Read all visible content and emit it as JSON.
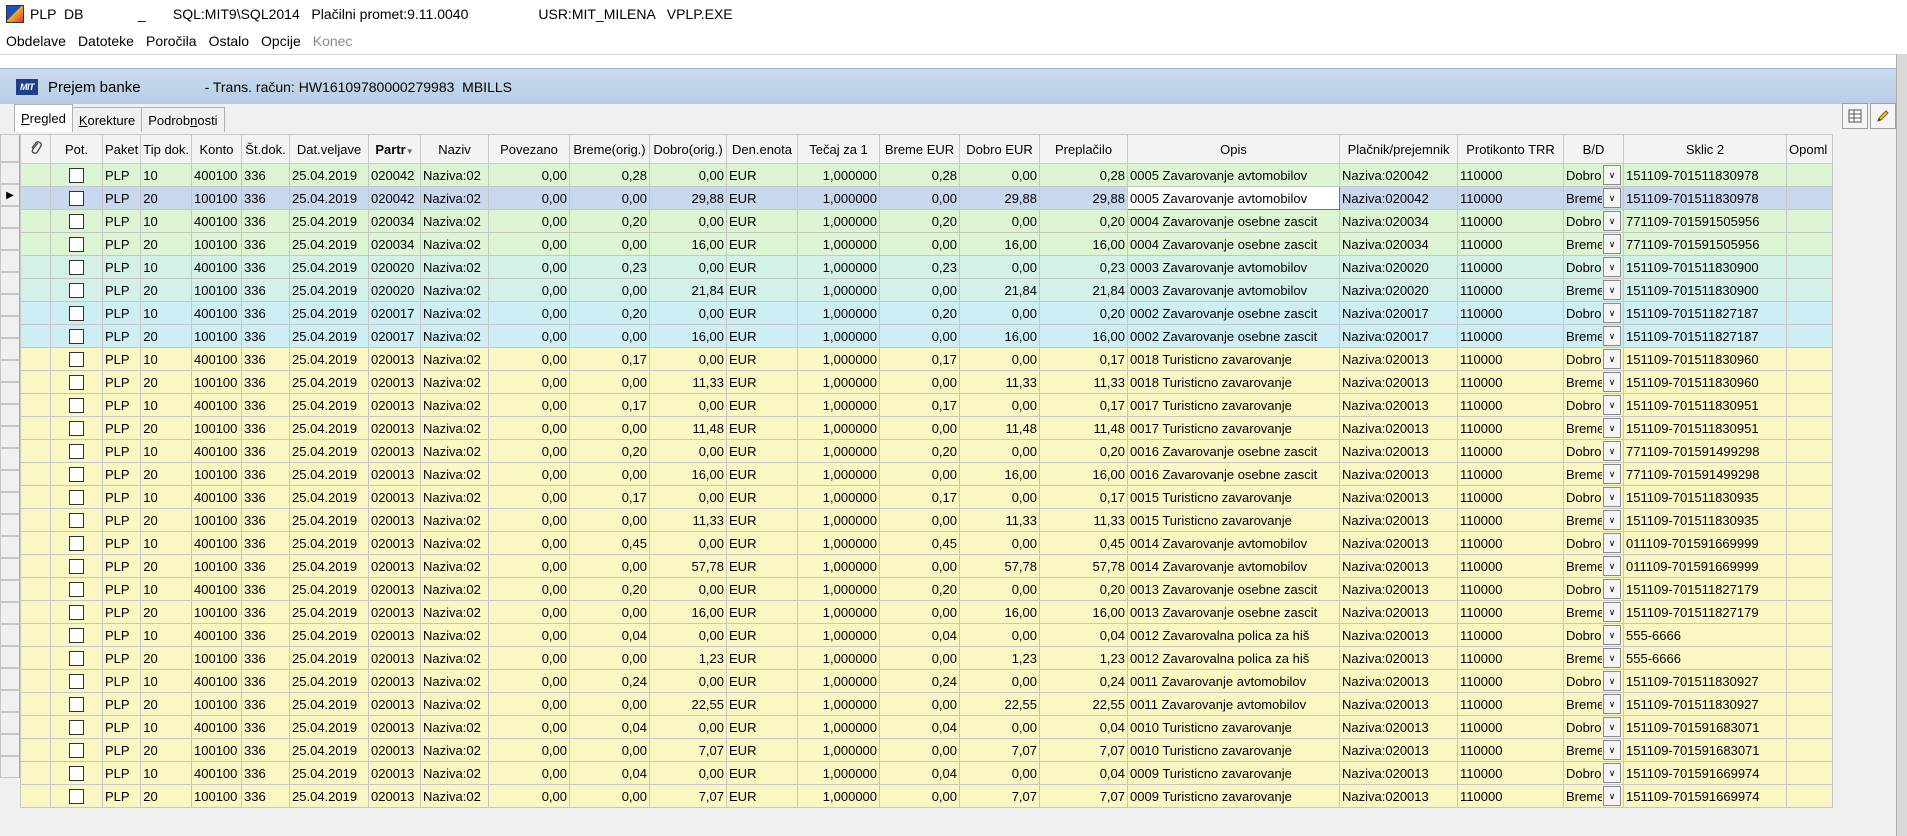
{
  "titlebar": {
    "text": "PLP  DB              _       SQL:MIT9\\SQL2014   Plačilni promet:9.11.0040                  USR:MIT_MILENA   VPLP.EXE"
  },
  "menu": [
    "Obdelave",
    "Datoteke",
    "Poročila",
    "Ostalo",
    "Opcije",
    "Konec"
  ],
  "form": {
    "logo": "MIT",
    "title": "Prejem banke",
    "subtitle": "- Trans. račun: HW16109780000279983  MBILLS"
  },
  "tabs": [
    {
      "pre": "",
      "key": "P",
      "post": "regled"
    },
    {
      "pre": "",
      "key": "K",
      "post": "orekture"
    },
    {
      "pre": "Podrob",
      "key": "n",
      "post": "osti"
    }
  ],
  "icons": {
    "attach": "paperclip-icon",
    "tool1": "grid-view-icon",
    "tool2": "pencil-icon"
  },
  "colors": {
    "green": "#dcf5d3",
    "teal": "#d3f1e6",
    "cyan": "#cdeef4",
    "yellow": "#fbf7c3",
    "selected": "#c8d8ef"
  },
  "columns": [
    "Pot.",
    "Paket",
    "Tip dok.",
    "Konto",
    "Št.dok.",
    "Dat.veljave",
    "Partr",
    "Naziv",
    "Povezano",
    "Breme(orig.)",
    "Dobro(orig.)",
    "Den.enota",
    "Tečaj za 1",
    "Breme EUR",
    "Dobro EUR",
    "Preplačilo",
    "Opis",
    "Plačnik/prejemnik",
    "Protikonto TRR",
    "B/D",
    "Sklic 2",
    "Opoml"
  ],
  "rows": [
    {
      "c": "g",
      "paket": "PLP",
      "tip": "10",
      "konto": "400100",
      "stdok": "336",
      "dat": "25.04.2019",
      "partner": "020042",
      "naziv": "Naziva:02",
      "povezano": "0,00",
      "breme_orig": "0,28",
      "dobro_orig": "0,00",
      "den": "EUR",
      "tecaj": "1,000000",
      "breme_eur": "0,28",
      "dobro_eur": "0,00",
      "preplacilo": "0,28",
      "opis": "0005 Zavarovanje avtomobilov",
      "placnik": "Naziva:020042",
      "protikonto": "110000",
      "bd": "Dobro",
      "sklic": "151109-701511830978"
    },
    {
      "c": "sel",
      "paket": "PLP",
      "tip": "20",
      "konto": "100100",
      "stdok": "336",
      "dat": "25.04.2019",
      "partner": "020042",
      "naziv": "Naziva:02",
      "povezano": "0,00",
      "breme_orig": "0,00",
      "dobro_orig": "29,88",
      "den": "EUR",
      "tecaj": "1,000000",
      "breme_eur": "0,00",
      "dobro_eur": "29,88",
      "preplacilo": "29,88",
      "opis": "0005 Zavarovanje avtomobilov",
      "placnik": "Naziva:020042",
      "protikonto": "110000",
      "bd": "Breme",
      "sklic": "151109-701511830978"
    },
    {
      "c": "g",
      "paket": "PLP",
      "tip": "10",
      "konto": "400100",
      "stdok": "336",
      "dat": "25.04.2019",
      "partner": "020034",
      "naziv": "Naziva:02",
      "povezano": "0,00",
      "breme_orig": "0,20",
      "dobro_orig": "0,00",
      "den": "EUR",
      "tecaj": "1,000000",
      "breme_eur": "0,20",
      "dobro_eur": "0,00",
      "preplacilo": "0,20",
      "opis": "0004 Zavarovanje osebne zascit",
      "placnik": "Naziva:020034",
      "protikonto": "110000",
      "bd": "Dobro",
      "sklic": "771109-701591505956"
    },
    {
      "c": "g",
      "paket": "PLP",
      "tip": "20",
      "konto": "100100",
      "stdok": "336",
      "dat": "25.04.2019",
      "partner": "020034",
      "naziv": "Naziva:02",
      "povezano": "0,00",
      "breme_orig": "0,00",
      "dobro_orig": "16,00",
      "den": "EUR",
      "tecaj": "1,000000",
      "breme_eur": "0,00",
      "dobro_eur": "16,00",
      "preplacilo": "16,00",
      "opis": "0004 Zavarovanje osebne zascit",
      "placnik": "Naziva:020034",
      "protikonto": "110000",
      "bd": "Breme",
      "sklic": "771109-701591505956"
    },
    {
      "c": "t",
      "paket": "PLP",
      "tip": "10",
      "konto": "400100",
      "stdok": "336",
      "dat": "25.04.2019",
      "partner": "020020",
      "naziv": "Naziva:02",
      "povezano": "0,00",
      "breme_orig": "0,23",
      "dobro_orig": "0,00",
      "den": "EUR",
      "tecaj": "1,000000",
      "breme_eur": "0,23",
      "dobro_eur": "0,00",
      "preplacilo": "0,23",
      "opis": "0003 Zavarovanje avtomobilov",
      "placnik": "Naziva:020020",
      "protikonto": "110000",
      "bd": "Dobro",
      "sklic": "151109-701511830900"
    },
    {
      "c": "t",
      "paket": "PLP",
      "tip": "20",
      "konto": "100100",
      "stdok": "336",
      "dat": "25.04.2019",
      "partner": "020020",
      "naziv": "Naziva:02",
      "povezano": "0,00",
      "breme_orig": "0,00",
      "dobro_orig": "21,84",
      "den": "EUR",
      "tecaj": "1,000000",
      "breme_eur": "0,00",
      "dobro_eur": "21,84",
      "preplacilo": "21,84",
      "opis": "0003 Zavarovanje avtomobilov",
      "placnik": "Naziva:020020",
      "protikonto": "110000",
      "bd": "Breme",
      "sklic": "151109-701511830900"
    },
    {
      "c": "c",
      "paket": "PLP",
      "tip": "10",
      "konto": "400100",
      "stdok": "336",
      "dat": "25.04.2019",
      "partner": "020017",
      "naziv": "Naziva:02",
      "povezano": "0,00",
      "breme_orig": "0,20",
      "dobro_orig": "0,00",
      "den": "EUR",
      "tecaj": "1,000000",
      "breme_eur": "0,20",
      "dobro_eur": "0,00",
      "preplacilo": "0,20",
      "opis": "0002 Zavarovanje osebne zascit",
      "placnik": "Naziva:020017",
      "protikonto": "110000",
      "bd": "Dobro",
      "sklic": "151109-701511827187"
    },
    {
      "c": "c",
      "paket": "PLP",
      "tip": "20",
      "konto": "100100",
      "stdok": "336",
      "dat": "25.04.2019",
      "partner": "020017",
      "naziv": "Naziva:02",
      "povezano": "0,00",
      "breme_orig": "0,00",
      "dobro_orig": "16,00",
      "den": "EUR",
      "tecaj": "1,000000",
      "breme_eur": "0,00",
      "dobro_eur": "16,00",
      "preplacilo": "16,00",
      "opis": "0002 Zavarovanje osebne zascit",
      "placnik": "Naziva:020017",
      "protikonto": "110000",
      "bd": "Breme",
      "sklic": "151109-701511827187"
    },
    {
      "c": "y",
      "paket": "PLP",
      "tip": "10",
      "konto": "400100",
      "stdok": "336",
      "dat": "25.04.2019",
      "partner": "020013",
      "naziv": "Naziva:02",
      "povezano": "0,00",
      "breme_orig": "0,17",
      "dobro_orig": "0,00",
      "den": "EUR",
      "tecaj": "1,000000",
      "breme_eur": "0,17",
      "dobro_eur": "0,00",
      "preplacilo": "0,17",
      "opis": "0018 Turisticno zavarovanje",
      "placnik": "Naziva:020013",
      "protikonto": "110000",
      "bd": "Dobro",
      "sklic": "151109-701511830960"
    },
    {
      "c": "y",
      "paket": "PLP",
      "tip": "20",
      "konto": "100100",
      "stdok": "336",
      "dat": "25.04.2019",
      "partner": "020013",
      "naziv": "Naziva:02",
      "povezano": "0,00",
      "breme_orig": "0,00",
      "dobro_orig": "11,33",
      "den": "EUR",
      "tecaj": "1,000000",
      "breme_eur": "0,00",
      "dobro_eur": "11,33",
      "preplacilo": "11,33",
      "opis": "0018 Turisticno zavarovanje",
      "placnik": "Naziva:020013",
      "protikonto": "110000",
      "bd": "Breme",
      "sklic": "151109-701511830960"
    },
    {
      "c": "y",
      "paket": "PLP",
      "tip": "10",
      "konto": "400100",
      "stdok": "336",
      "dat": "25.04.2019",
      "partner": "020013",
      "naziv": "Naziva:02",
      "povezano": "0,00",
      "breme_orig": "0,17",
      "dobro_orig": "0,00",
      "den": "EUR",
      "tecaj": "1,000000",
      "breme_eur": "0,17",
      "dobro_eur": "0,00",
      "preplacilo": "0,17",
      "opis": "0017 Turisticno zavarovanje",
      "placnik": "Naziva:020013",
      "protikonto": "110000",
      "bd": "Dobro",
      "sklic": "151109-701511830951"
    },
    {
      "c": "y",
      "paket": "PLP",
      "tip": "20",
      "konto": "100100",
      "stdok": "336",
      "dat": "25.04.2019",
      "partner": "020013",
      "naziv": "Naziva:02",
      "povezano": "0,00",
      "breme_orig": "0,00",
      "dobro_orig": "11,48",
      "den": "EUR",
      "tecaj": "1,000000",
      "breme_eur": "0,00",
      "dobro_eur": "11,48",
      "preplacilo": "11,48",
      "opis": "0017 Turisticno zavarovanje",
      "placnik": "Naziva:020013",
      "protikonto": "110000",
      "bd": "Breme",
      "sklic": "151109-701511830951"
    },
    {
      "c": "y",
      "paket": "PLP",
      "tip": "10",
      "konto": "400100",
      "stdok": "336",
      "dat": "25.04.2019",
      "partner": "020013",
      "naziv": "Naziva:02",
      "povezano": "0,00",
      "breme_orig": "0,20",
      "dobro_orig": "0,00",
      "den": "EUR",
      "tecaj": "1,000000",
      "breme_eur": "0,20",
      "dobro_eur": "0,00",
      "preplacilo": "0,20",
      "opis": "0016 Zavarovanje osebne zascit",
      "placnik": "Naziva:020013",
      "protikonto": "110000",
      "bd": "Dobro",
      "sklic": "771109-701591499298"
    },
    {
      "c": "y",
      "paket": "PLP",
      "tip": "20",
      "konto": "100100",
      "stdok": "336",
      "dat": "25.04.2019",
      "partner": "020013",
      "naziv": "Naziva:02",
      "povezano": "0,00",
      "breme_orig": "0,00",
      "dobro_orig": "16,00",
      "den": "EUR",
      "tecaj": "1,000000",
      "breme_eur": "0,00",
      "dobro_eur": "16,00",
      "preplacilo": "16,00",
      "opis": "0016 Zavarovanje osebne zascit",
      "placnik": "Naziva:020013",
      "protikonto": "110000",
      "bd": "Breme",
      "sklic": "771109-701591499298"
    },
    {
      "c": "y",
      "paket": "PLP",
      "tip": "10",
      "konto": "400100",
      "stdok": "336",
      "dat": "25.04.2019",
      "partner": "020013",
      "naziv": "Naziva:02",
      "povezano": "0,00",
      "breme_orig": "0,17",
      "dobro_orig": "0,00",
      "den": "EUR",
      "tecaj": "1,000000",
      "breme_eur": "0,17",
      "dobro_eur": "0,00",
      "preplacilo": "0,17",
      "opis": "0015 Turisticno zavarovanje",
      "placnik": "Naziva:020013",
      "protikonto": "110000",
      "bd": "Dobro",
      "sklic": "151109-701511830935"
    },
    {
      "c": "y",
      "paket": "PLP",
      "tip": "20",
      "konto": "100100",
      "stdok": "336",
      "dat": "25.04.2019",
      "partner": "020013",
      "naziv": "Naziva:02",
      "povezano": "0,00",
      "breme_orig": "0,00",
      "dobro_orig": "11,33",
      "den": "EUR",
      "tecaj": "1,000000",
      "breme_eur": "0,00",
      "dobro_eur": "11,33",
      "preplacilo": "11,33",
      "opis": "0015 Turisticno zavarovanje",
      "placnik": "Naziva:020013",
      "protikonto": "110000",
      "bd": "Breme",
      "sklic": "151109-701511830935"
    },
    {
      "c": "y",
      "paket": "PLP",
      "tip": "10",
      "konto": "400100",
      "stdok": "336",
      "dat": "25.04.2019",
      "partner": "020013",
      "naziv": "Naziva:02",
      "povezano": "0,00",
      "breme_orig": "0,45",
      "dobro_orig": "0,00",
      "den": "EUR",
      "tecaj": "1,000000",
      "breme_eur": "0,45",
      "dobro_eur": "0,00",
      "preplacilo": "0,45",
      "opis": "0014 Zavarovanje avtomobilov",
      "placnik": "Naziva:020013",
      "protikonto": "110000",
      "bd": "Dobro",
      "sklic": "011109-701591669999"
    },
    {
      "c": "y",
      "paket": "PLP",
      "tip": "20",
      "konto": "100100",
      "stdok": "336",
      "dat": "25.04.2019",
      "partner": "020013",
      "naziv": "Naziva:02",
      "povezano": "0,00",
      "breme_orig": "0,00",
      "dobro_orig": "57,78",
      "den": "EUR",
      "tecaj": "1,000000",
      "breme_eur": "0,00",
      "dobro_eur": "57,78",
      "preplacilo": "57,78",
      "opis": "0014 Zavarovanje avtomobilov",
      "placnik": "Naziva:020013",
      "protikonto": "110000",
      "bd": "Breme",
      "sklic": "011109-701591669999"
    },
    {
      "c": "y",
      "paket": "PLP",
      "tip": "10",
      "konto": "400100",
      "stdok": "336",
      "dat": "25.04.2019",
      "partner": "020013",
      "naziv": "Naziva:02",
      "povezano": "0,00",
      "breme_orig": "0,20",
      "dobro_orig": "0,00",
      "den": "EUR",
      "tecaj": "1,000000",
      "breme_eur": "0,20",
      "dobro_eur": "0,00",
      "preplacilo": "0,20",
      "opis": "0013 Zavarovanje osebne zascit",
      "placnik": "Naziva:020013",
      "protikonto": "110000",
      "bd": "Dobro",
      "sklic": "151109-701511827179"
    },
    {
      "c": "y",
      "paket": "PLP",
      "tip": "20",
      "konto": "100100",
      "stdok": "336",
      "dat": "25.04.2019",
      "partner": "020013",
      "naziv": "Naziva:02",
      "povezano": "0,00",
      "breme_orig": "0,00",
      "dobro_orig": "16,00",
      "den": "EUR",
      "tecaj": "1,000000",
      "breme_eur": "0,00",
      "dobro_eur": "16,00",
      "preplacilo": "16,00",
      "opis": "0013 Zavarovanje osebne zascit",
      "placnik": "Naziva:020013",
      "protikonto": "110000",
      "bd": "Breme",
      "sklic": "151109-701511827179"
    },
    {
      "c": "y",
      "paket": "PLP",
      "tip": "10",
      "konto": "400100",
      "stdok": "336",
      "dat": "25.04.2019",
      "partner": "020013",
      "naziv": "Naziva:02",
      "povezano": "0,00",
      "breme_orig": "0,04",
      "dobro_orig": "0,00",
      "den": "EUR",
      "tecaj": "1,000000",
      "breme_eur": "0,04",
      "dobro_eur": "0,00",
      "preplacilo": "0,04",
      "opis": "0012 Zavarovalna polica za hiš",
      "placnik": "Naziva:020013",
      "protikonto": "110000",
      "bd": "Dobro",
      "sklic": "555-6666"
    },
    {
      "c": "y",
      "paket": "PLP",
      "tip": "20",
      "konto": "100100",
      "stdok": "336",
      "dat": "25.04.2019",
      "partner": "020013",
      "naziv": "Naziva:02",
      "povezano": "0,00",
      "breme_orig": "0,00",
      "dobro_orig": "1,23",
      "den": "EUR",
      "tecaj": "1,000000",
      "breme_eur": "0,00",
      "dobro_eur": "1,23",
      "preplacilo": "1,23",
      "opis": "0012 Zavarovalna polica za hiš",
      "placnik": "Naziva:020013",
      "protikonto": "110000",
      "bd": "Breme",
      "sklic": "555-6666"
    },
    {
      "c": "y",
      "paket": "PLP",
      "tip": "10",
      "konto": "400100",
      "stdok": "336",
      "dat": "25.04.2019",
      "partner": "020013",
      "naziv": "Naziva:02",
      "povezano": "0,00",
      "breme_orig": "0,24",
      "dobro_orig": "0,00",
      "den": "EUR",
      "tecaj": "1,000000",
      "breme_eur": "0,24",
      "dobro_eur": "0,00",
      "preplacilo": "0,24",
      "opis": "0011 Zavarovanje avtomobilov",
      "placnik": "Naziva:020013",
      "protikonto": "110000",
      "bd": "Dobro",
      "sklic": "151109-701511830927"
    },
    {
      "c": "y",
      "paket": "PLP",
      "tip": "20",
      "konto": "100100",
      "stdok": "336",
      "dat": "25.04.2019",
      "partner": "020013",
      "naziv": "Naziva:02",
      "povezano": "0,00",
      "breme_orig": "0,00",
      "dobro_orig": "22,55",
      "den": "EUR",
      "tecaj": "1,000000",
      "breme_eur": "0,00",
      "dobro_eur": "22,55",
      "preplacilo": "22,55",
      "opis": "0011 Zavarovanje avtomobilov",
      "placnik": "Naziva:020013",
      "protikonto": "110000",
      "bd": "Breme",
      "sklic": "151109-701511830927"
    },
    {
      "c": "y",
      "paket": "PLP",
      "tip": "10",
      "konto": "400100",
      "stdok": "336",
      "dat": "25.04.2019",
      "partner": "020013",
      "naziv": "Naziva:02",
      "povezano": "0,00",
      "breme_orig": "0,04",
      "dobro_orig": "0,00",
      "den": "EUR",
      "tecaj": "1,000000",
      "breme_eur": "0,04",
      "dobro_eur": "0,00",
      "preplacilo": "0,04",
      "opis": "0010 Turisticno zavarovanje",
      "placnik": "Naziva:020013",
      "protikonto": "110000",
      "bd": "Dobro",
      "sklic": "151109-701591683071"
    },
    {
      "c": "y",
      "paket": "PLP",
      "tip": "20",
      "konto": "100100",
      "stdok": "336",
      "dat": "25.04.2019",
      "partner": "020013",
      "naziv": "Naziva:02",
      "povezano": "0,00",
      "breme_orig": "0,00",
      "dobro_orig": "7,07",
      "den": "EUR",
      "tecaj": "1,000000",
      "breme_eur": "0,00",
      "dobro_eur": "7,07",
      "preplacilo": "7,07",
      "opis": "0010 Turisticno zavarovanje",
      "placnik": "Naziva:020013",
      "protikonto": "110000",
      "bd": "Breme",
      "sklic": "151109-701591683071"
    },
    {
      "c": "y",
      "paket": "PLP",
      "tip": "10",
      "konto": "400100",
      "stdok": "336",
      "dat": "25.04.2019",
      "partner": "020013",
      "naziv": "Naziva:02",
      "povezano": "0,00",
      "breme_orig": "0,04",
      "dobro_orig": "0,00",
      "den": "EUR",
      "tecaj": "1,000000",
      "breme_eur": "0,04",
      "dobro_eur": "0,00",
      "preplacilo": "0,04",
      "opis": "0009 Turisticno zavarovanje",
      "placnik": "Naziva:020013",
      "protikonto": "110000",
      "bd": "Dobro",
      "sklic": "151109-701591669974"
    },
    {
      "c": "y",
      "paket": "PLP",
      "tip": "20",
      "konto": "100100",
      "stdok": "336",
      "dat": "25.04.2019",
      "partner": "020013",
      "naziv": "Naziva:02",
      "povezano": "0,00",
      "breme_orig": "0,00",
      "dobro_orig": "7,07",
      "den": "EUR",
      "tecaj": "1,000000",
      "breme_eur": "0,00",
      "dobro_eur": "7,07",
      "preplacilo": "7,07",
      "opis": "0009 Turisticno zavarovanje",
      "placnik": "Naziva:020013",
      "protikonto": "110000",
      "bd": "Breme",
      "sklic": "151109-701591669974"
    }
  ]
}
